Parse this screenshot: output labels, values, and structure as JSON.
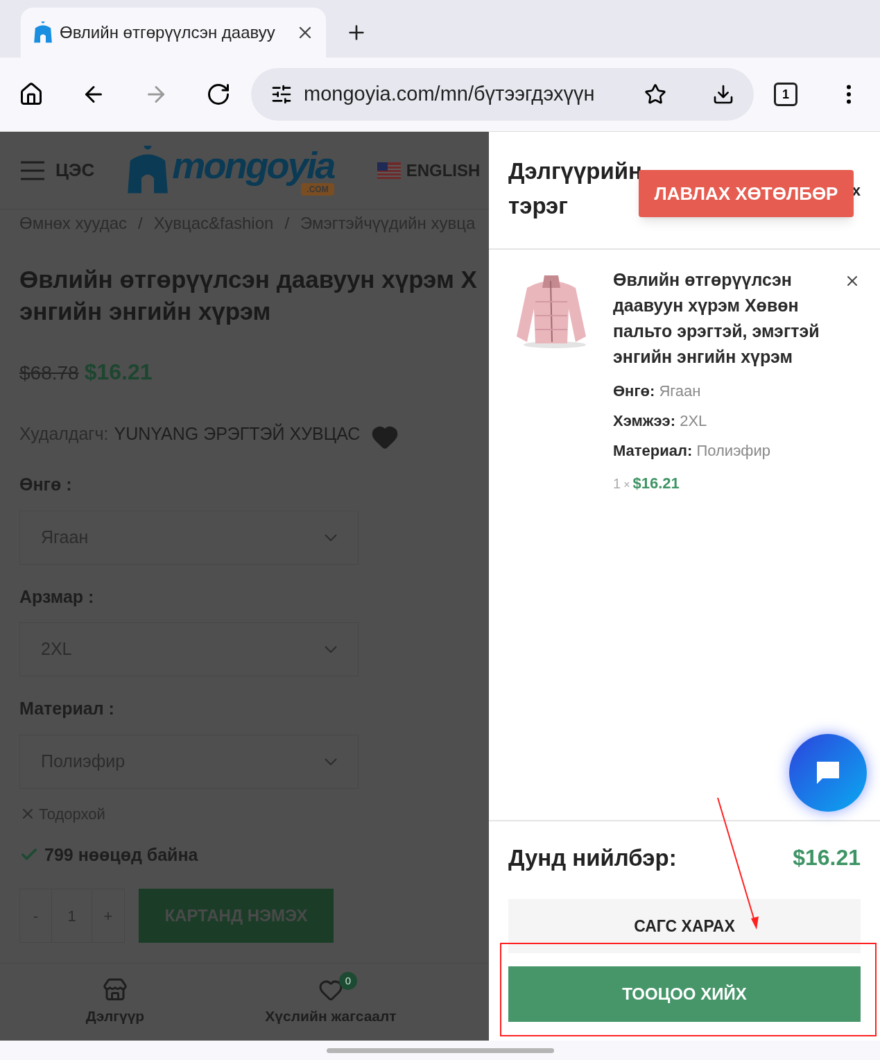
{
  "browser": {
    "tab_title": "Өвлийн өтгөрүүлсэн даавуу",
    "url": "mongoyia.com/mn/бүтээгдэхүүн",
    "tab_count": "1"
  },
  "page": {
    "menu_label": "ЦЭС",
    "logo_text": "mongoyia",
    "logo_suffix": ".COM",
    "language": "ENGLISH",
    "breadcrumb": [
      "Өмнөх хуудас",
      "Хувцас&fashion",
      "Эмэгтэйчүүдийн хувца"
    ],
    "breadcrumb_separator": "/",
    "title_lines": [
      "Өвлийн өтгөрүүлсэн даавуун хүрэм Х",
      "энгийн энгийн хүрэм"
    ],
    "old_price": "$68.78",
    "price": "$16.21",
    "seller_label": "Худалдагч:",
    "seller_name": "YUNYANG ЭРЭГТЭЙ ХУВЦАС",
    "options": [
      {
        "label": "Өнгө :",
        "value": "Ягаан"
      },
      {
        "label": "Арзмар :",
        "value": "2XL"
      },
      {
        "label": "Материал :",
        "value": "Полиэфир"
      }
    ],
    "clear_label": "Тодорхой",
    "stock_text": "799 нөөцөд байна",
    "quantity": "1",
    "minus": "-",
    "plus": "+",
    "add_to_cart": "КАРТАНД НЭМЭХ",
    "bottom_nav": [
      {
        "kind": "store",
        "label": "Дэлгүүр"
      },
      {
        "kind": "wishlist",
        "label": "Хүслийн жагсаалт",
        "badge": "0"
      }
    ]
  },
  "cart": {
    "title_lines": [
      "Дэлгүүрийн",
      "тэрэг"
    ],
    "close": "x",
    "promo_button": "ЛАВЛАХ ХӨТӨЛБӨР",
    "items": [
      {
        "title": "Өвлийн өтгөрүүлсэн даавуун хүрэм Хөвөн пальто эрэгтэй, эмэгтэй энгийн энгийн хүрэм",
        "attributes": [
          "**Өнгө:** Ягаан",
          "**Хэмжээ:** 2XL",
          "**Материал:** Полиэфир"
        ],
        "quantity": "1",
        "times": "×",
        "price": "$16.21"
      }
    ],
    "subtotal_label": "Дунд нийлбэр:",
    "subtotal": "$16.21",
    "view_cart": "САГС ХАРАХ",
    "checkout": "ТООЦОО ХИЙХ"
  }
}
